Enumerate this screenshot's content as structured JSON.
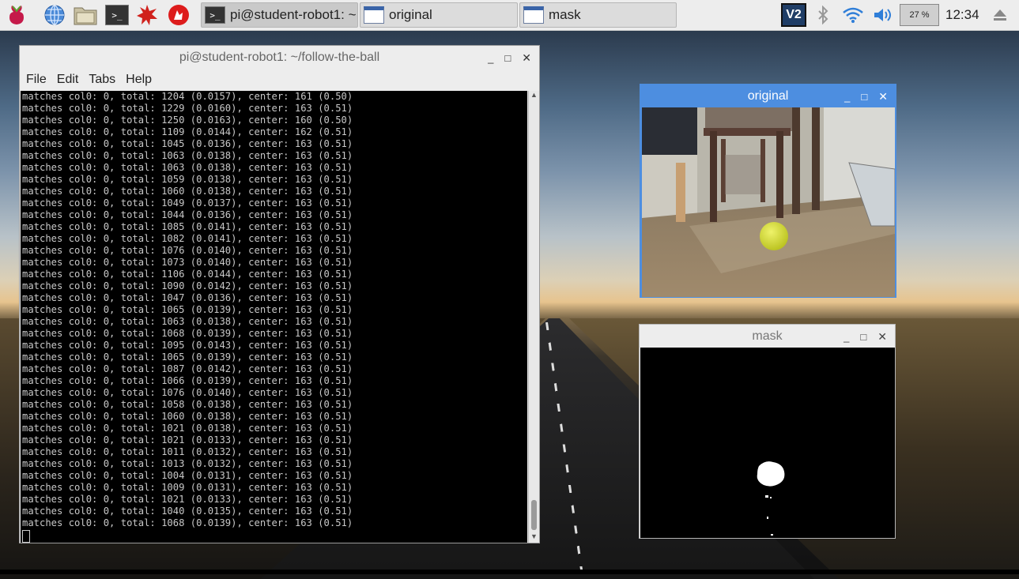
{
  "taskbar": {
    "launchers": [
      "raspberry-menu",
      "web-browser",
      "file-manager",
      "terminal",
      "mathematica",
      "wolfram"
    ],
    "tasks": [
      {
        "label": "pi@student-robot1: ~",
        "icon": "terminal-icon"
      },
      {
        "label": "original",
        "icon": "window-icon"
      },
      {
        "label": "mask",
        "icon": "window-icon"
      }
    ],
    "tray": {
      "vnc": "V2",
      "cpu": "27 %",
      "clock": "12:34"
    }
  },
  "terminal": {
    "title": "pi@student-robot1: ~/follow-the-ball",
    "menu": [
      "File",
      "Edit",
      "Tabs",
      "Help"
    ],
    "lines": [
      "matches col0: 0, total: 1204 (0.0157), center: 161 (0.50)",
      "matches col0: 0, total: 1229 (0.0160), center: 163 (0.51)",
      "matches col0: 0, total: 1250 (0.0163), center: 160 (0.50)",
      "matches col0: 0, total: 1109 (0.0144), center: 162 (0.51)",
      "matches col0: 0, total: 1045 (0.0136), center: 163 (0.51)",
      "matches col0: 0, total: 1063 (0.0138), center: 163 (0.51)",
      "matches col0: 0, total: 1063 (0.0138), center: 163 (0.51)",
      "matches col0: 0, total: 1059 (0.0138), center: 163 (0.51)",
      "matches col0: 0, total: 1060 (0.0138), center: 163 (0.51)",
      "matches col0: 0, total: 1049 (0.0137), center: 163 (0.51)",
      "matches col0: 0, total: 1044 (0.0136), center: 163 (0.51)",
      "matches col0: 0, total: 1085 (0.0141), center: 163 (0.51)",
      "matches col0: 0, total: 1082 (0.0141), center: 163 (0.51)",
      "matches col0: 0, total: 1076 (0.0140), center: 163 (0.51)",
      "matches col0: 0, total: 1073 (0.0140), center: 163 (0.51)",
      "matches col0: 0, total: 1106 (0.0144), center: 163 (0.51)",
      "matches col0: 0, total: 1090 (0.0142), center: 163 (0.51)",
      "matches col0: 0, total: 1047 (0.0136), center: 163 (0.51)",
      "matches col0: 0, total: 1065 (0.0139), center: 163 (0.51)",
      "matches col0: 0, total: 1063 (0.0138), center: 163 (0.51)",
      "matches col0: 0, total: 1068 (0.0139), center: 163 (0.51)",
      "matches col0: 0, total: 1095 (0.0143), center: 163 (0.51)",
      "matches col0: 0, total: 1065 (0.0139), center: 163 (0.51)",
      "matches col0: 0, total: 1087 (0.0142), center: 163 (0.51)",
      "matches col0: 0, total: 1066 (0.0139), center: 163 (0.51)",
      "matches col0: 0, total: 1076 (0.0140), center: 163 (0.51)",
      "matches col0: 0, total: 1058 (0.0138), center: 163 (0.51)",
      "matches col0: 0, total: 1060 (0.0138), center: 163 (0.51)",
      "matches col0: 0, total: 1021 (0.0138), center: 163 (0.51)",
      "matches col0: 0, total: 1021 (0.0133), center: 163 (0.51)",
      "matches col0: 0, total: 1011 (0.0132), center: 163 (0.51)",
      "matches col0: 0, total: 1013 (0.0132), center: 163 (0.51)",
      "matches col0: 0, total: 1004 (0.0131), center: 163 (0.51)",
      "matches col0: 0, total: 1009 (0.0131), center: 163 (0.51)",
      "matches col0: 0, total: 1021 (0.0133), center: 163 (0.51)",
      "matches col0: 0, total: 1040 (0.0135), center: 163 (0.51)",
      "matches col0: 0, total: 1068 (0.0139), center: 163 (0.51)"
    ]
  },
  "original_window": {
    "title": "original"
  },
  "mask_window": {
    "title": "mask"
  },
  "colors": {
    "active_titlebar": "#4d8ee0",
    "terminal_bg": "#000000",
    "terminal_fg": "#c8c8c8",
    "ball": "#d6e03a"
  }
}
